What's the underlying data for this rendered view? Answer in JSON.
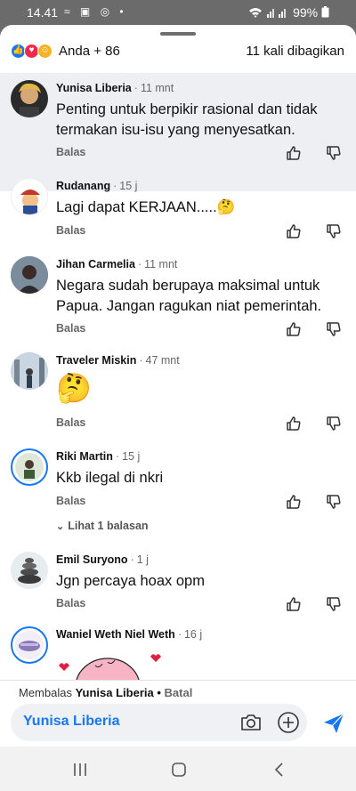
{
  "status": {
    "time": "14.41",
    "battery": "99%",
    "left_icons": "≈ ▣ ◎ •"
  },
  "reactions": {
    "summary": "Anda + 86",
    "shares": "11 kali dibagikan",
    "icons": [
      "like-reaction-icon",
      "love-reaction-icon",
      "care-reaction-icon"
    ],
    "colors": {
      "like": "#1877f2",
      "love": "#f0284a",
      "care": "#f7b125"
    }
  },
  "comments": [
    {
      "name": "Yunisa Liberia",
      "time": "11 mnt",
      "text": "Penting untuk berpikir rasional dan tidak termakan isu-isu yang menyesatkan.",
      "reply": "Balas"
    },
    {
      "name": "Rudanang",
      "time": "15 j",
      "text": "Lagi dapat KERJAAN.....🤔",
      "reply": "Balas"
    },
    {
      "name": "Jihan Carmelia",
      "time": "11 mnt",
      "text": "Negara sudah berupaya maksimal untuk Papua. Jangan ragukan niat pemerintah.",
      "reply": "Balas"
    },
    {
      "name": "Traveler Miskin",
      "time": "47 mnt",
      "text": "🤔",
      "reply": "Balas"
    },
    {
      "name": "Riki Martin",
      "time": "15 j",
      "text": "Kkb ilegal di nkri",
      "reply": "Balas",
      "more": "Lihat 1 balasan"
    },
    {
      "name": "Emil Suryono",
      "time": "1 j",
      "text": "Jgn percaya hoax opm",
      "reply": "Balas"
    },
    {
      "name": "Waniel Weth Niel Weth",
      "time": "16 j"
    }
  ],
  "replying": {
    "prefix": "Membalas ",
    "name": "Yunisa Liberia",
    "separator": " • ",
    "cancel": "Batal"
  },
  "input": {
    "value": "Yunisa Liberia"
  },
  "colors": {
    "accent": "#1877f2",
    "highlight_bg": "#eeeff3"
  }
}
